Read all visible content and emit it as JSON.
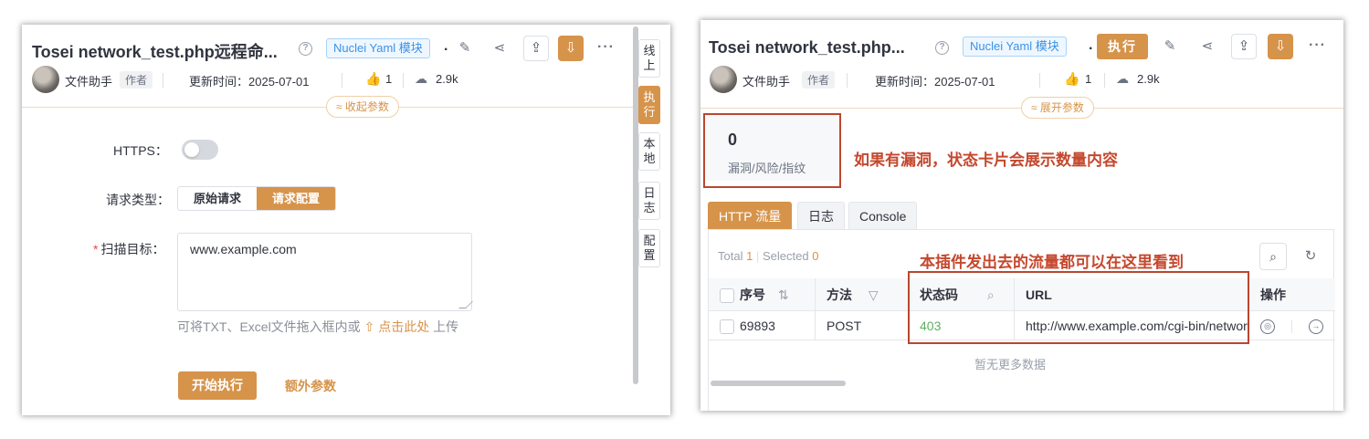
{
  "left": {
    "title": "Tosei network_test.php远程命...",
    "help_glyph": "?",
    "tag": "Nuclei Yaml 模块",
    "dot": ".",
    "toolbar": {
      "edit_icon": "✎",
      "share_icon": "⋖",
      "upload_icon": "⇪",
      "download_icon": "⇩",
      "more_icon": "···"
    },
    "author_name": "文件助手",
    "author_tag": "作者",
    "updated": "更新时间：2025-07-01",
    "likes": "1",
    "downloads": "2.9k",
    "like_icon": "👍",
    "download_count_icon": "☁",
    "collapse_label": "≈ 收起参数",
    "form": {
      "https_label": "HTTPS：",
      "request_type_label": "请求类型：",
      "request_type_options": [
        "原始请求",
        "请求配置"
      ],
      "target_star": "*",
      "target_label": "扫描目标：",
      "target_value": "www.example.com",
      "hint_prefix": "可将TXT、Excel文件拖入框内或",
      "hint_link": "⇧ 点击此处",
      "hint_suffix": "上传",
      "start_button": "开始执行",
      "extra_params": "额外参数"
    },
    "side_tabs": [
      "线上",
      "执行",
      "本地",
      "日志",
      "配置"
    ]
  },
  "right": {
    "title": "Tosei network_test.php...",
    "help_glyph": "?",
    "tag": "Nuclei Yaml 模块",
    "dot": ".",
    "exec_button": "执行",
    "toolbar": {
      "edit_icon": "✎",
      "share_icon": "⋖",
      "upload_icon": "⇪",
      "download_icon": "⇩",
      "more_icon": "···"
    },
    "author_name": "文件助手",
    "author_tag": "作者",
    "updated": "更新时间：2025-07-01",
    "likes": "1",
    "downloads": "2.9k",
    "like_icon": "👍",
    "download_count_icon": "☁",
    "expand_label": "≈ 展开参数",
    "stat": {
      "value": "0",
      "label": "漏洞/风险/指纹"
    },
    "annotation_card": "如果有漏洞，状态卡片会展示数量内容",
    "annotation_traffic": "本插件发出去的流量都可以在这里看到",
    "tabs": [
      "HTTP 流量",
      "日志",
      "Console"
    ],
    "counts": {
      "total_label": "Total",
      "total": "1",
      "selected_label": "Selected",
      "selected": "0"
    },
    "search_icon": "⌕",
    "refresh_icon": "↻",
    "table": {
      "headers": [
        "序号",
        "方法",
        "状态码",
        "URL",
        "操作"
      ],
      "sort_icon": "⇅",
      "filter_icon": "▽",
      "rows": [
        {
          "id": "69893",
          "method": "POST",
          "status": "403",
          "url": "http://www.example.com/cgi-bin/network_test.php",
          "action_icon_1": "◎",
          "action_icon_2": "→"
        }
      ],
      "empty_text": "暂无更多数据"
    }
  }
}
